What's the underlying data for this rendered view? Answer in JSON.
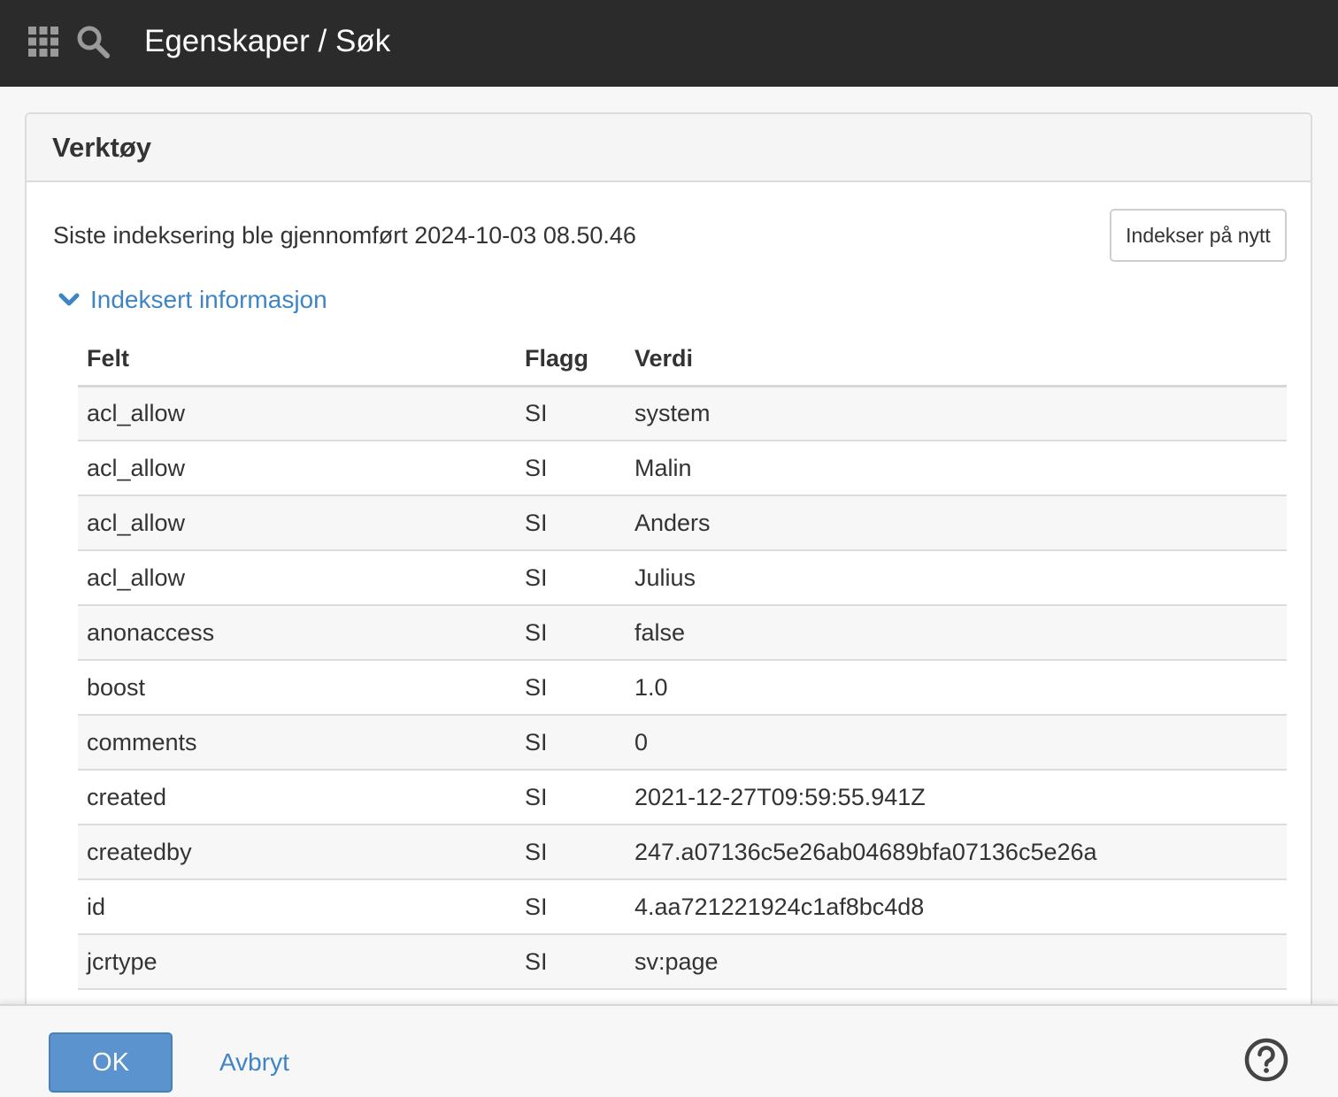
{
  "header": {
    "title": "Egenskaper / Søk",
    "icons": [
      "apps-grid-icon",
      "search-icon"
    ]
  },
  "panel": {
    "title": "Verktøy",
    "status_text": "Siste indeksering ble gjennomført 2024-10-03 08.50.46",
    "reindex_label": "Indekser på nytt",
    "toggle_label": "Indeksert informasjon"
  },
  "table": {
    "headers": [
      "Felt",
      "Flagg",
      "Verdi"
    ],
    "rows": [
      [
        "acl_allow",
        "SI",
        "system"
      ],
      [
        "acl_allow",
        "SI",
        "Malin"
      ],
      [
        "acl_allow",
        "SI",
        "Anders"
      ],
      [
        "acl_allow",
        "SI",
        "Julius"
      ],
      [
        "anonaccess",
        "SI",
        "false"
      ],
      [
        "boost",
        "SI",
        "1.0"
      ],
      [
        "comments",
        "SI",
        "0"
      ],
      [
        "created",
        "SI",
        "2021-12-27T09:59:55.941Z"
      ],
      [
        "createdby",
        "SI",
        "247.a07136c5e26ab04689bfa07136c5e26a"
      ],
      [
        "id",
        "SI",
        "4.aa721221924c1af8bc4d8"
      ],
      [
        "jcrtype",
        "SI",
        "sv:page"
      ]
    ]
  },
  "footer": {
    "ok_label": "OK",
    "cancel_label": "Avbryt",
    "help_icon": "help-circle-icon"
  },
  "colors": {
    "topbar": "#2b2b2b",
    "link": "#3f84c5",
    "primary_button": "#5b93cf"
  }
}
